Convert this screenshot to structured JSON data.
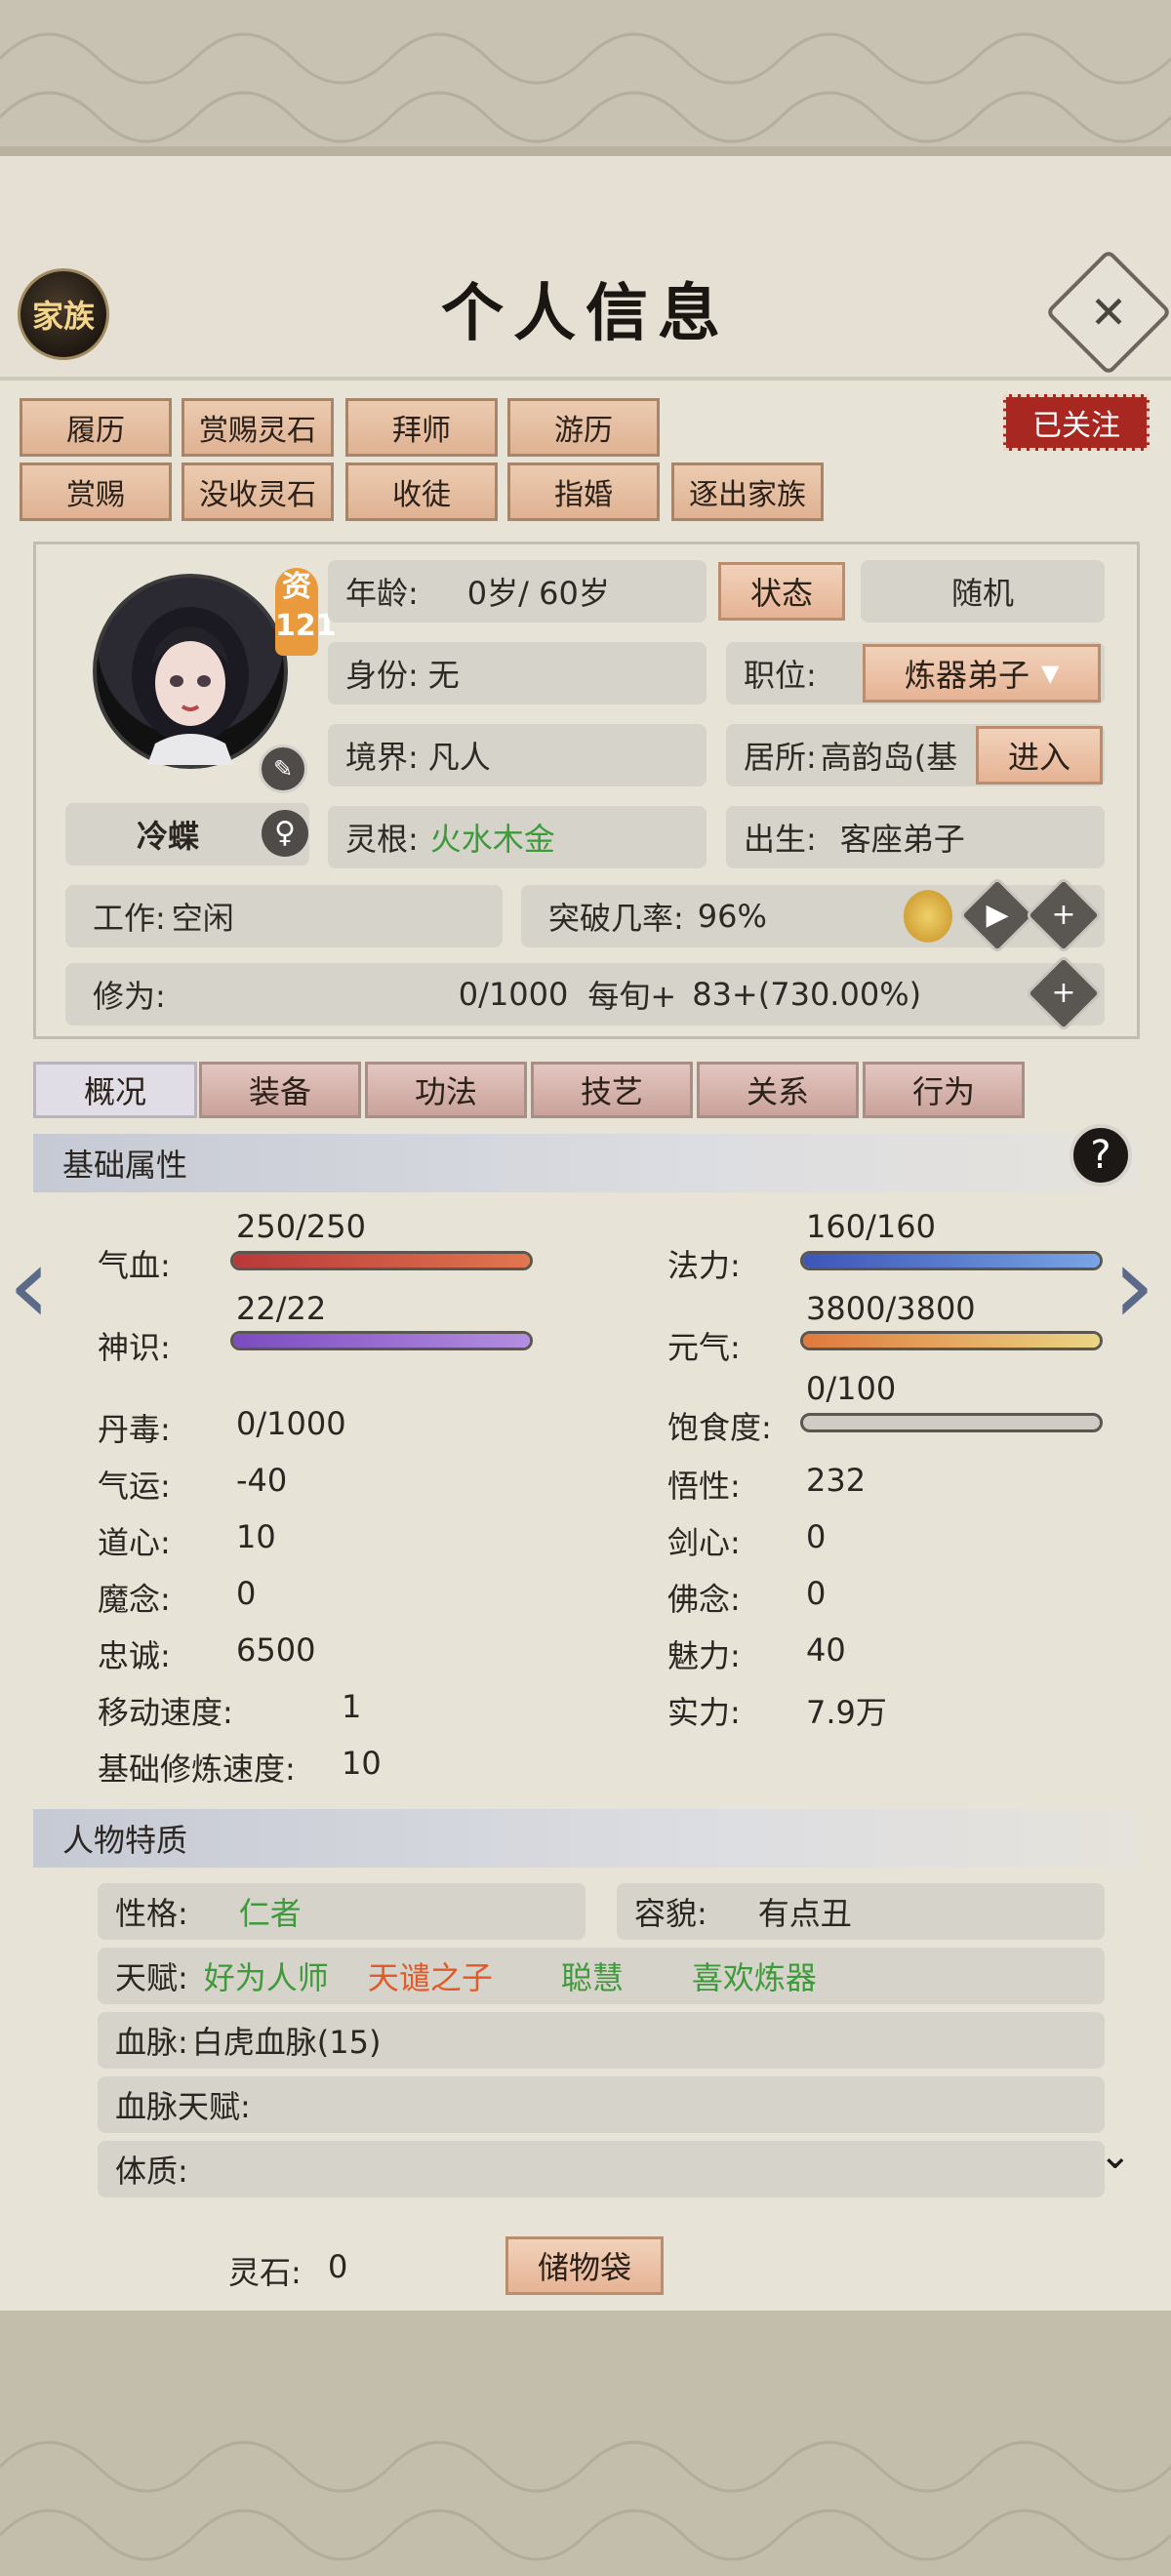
{
  "header": {
    "title": "个人信息",
    "family_label": "家族",
    "close_symbol": "✕",
    "follow_label": "已关注"
  },
  "toolbar_row1": [
    "履历",
    "赏赐灵石",
    "拜师",
    "游历"
  ],
  "toolbar_row2": [
    "赏赐",
    "没收灵石",
    "收徒",
    "指婚",
    "逐出家族"
  ],
  "profile": {
    "aptitude_label": "资",
    "aptitude_value": "121",
    "name": "冷蝶",
    "gender_symbol": "♀",
    "age_label": "年龄:",
    "age_value": "0岁/ 60岁",
    "status_button": "状态",
    "random_button": "随机",
    "identity_label": "身份:",
    "identity_value": "无",
    "position_label": "职位:",
    "position_value": "炼器弟子",
    "realm_label": "境界:",
    "realm_value": "凡人",
    "residence_label": "居所:",
    "residence_value": "高韵岛(基",
    "enter_button": "进入",
    "root_label": "灵根:",
    "root_value": "火水木金",
    "birth_label": "出生:",
    "birth_value": "客座弟子",
    "work_label": "工作:",
    "work_value": "空闲",
    "breakthrough_label": "突破几率:",
    "breakthrough_value": "96%",
    "cultivation_label": "修为:",
    "cultivation_value": "0/1000",
    "per_period_label": "每旬+",
    "per_period_value": "83+(730.00%)"
  },
  "tabs": [
    "概况",
    "装备",
    "功法",
    "技艺",
    "关系",
    "行为"
  ],
  "basic": {
    "section_title": "基础属性",
    "help_symbol": "?",
    "hp": {
      "label": "气血:",
      "text": "250/250",
      "fraction": 1.0
    },
    "mana": {
      "label": "法力:",
      "text": "160/160",
      "fraction": 1.0
    },
    "spirit": {
      "label": "神识:",
      "text": "22/22",
      "fraction": 1.0
    },
    "vital": {
      "label": "元气:",
      "text": "3800/3800",
      "fraction": 1.0
    },
    "satiety": {
      "label": "饱食度:",
      "text": "0/100",
      "fraction": 0.0
    },
    "rows": [
      {
        "l_label": "丹毒:",
        "l_value": "0/1000",
        "r_label": "",
        "r_value": ""
      },
      {
        "l_label": "气运:",
        "l_value": "-40",
        "r_label": "悟性:",
        "r_value": "232"
      },
      {
        "l_label": "道心:",
        "l_value": "10",
        "r_label": "剑心:",
        "r_value": "0"
      },
      {
        "l_label": "魔念:",
        "l_value": "0",
        "r_label": "佛念:",
        "r_value": "0"
      },
      {
        "l_label": "忠诚:",
        "l_value": "6500",
        "r_label": "魅力:",
        "r_value": "40"
      },
      {
        "l_label": "移动速度:",
        "l_value": "1",
        "r_label": "实力:",
        "r_value": "7.9万"
      },
      {
        "l_label": "基础修炼速度:",
        "l_value": "10",
        "r_label": "",
        "r_value": ""
      }
    ]
  },
  "traits": {
    "section_title": "人物特质",
    "personality_label": "性格:",
    "personality_value": "仁者",
    "looks_label": "容貌:",
    "looks_value": "有点丑",
    "talent_label": "天赋:",
    "talents": [
      "好为人师",
      "天谴之子",
      "聪慧",
      "喜欢炼器"
    ],
    "bloodline_label": "血脉:",
    "bloodline_value": "白虎血脉(15)",
    "bloodline_talent_label": "血脉天赋:",
    "physique_label": "体质:"
  },
  "footer": {
    "spirit_stone_label": "灵石:",
    "spirit_stone_value": "0",
    "bag_button": "储物袋"
  },
  "colors": {
    "hp": "#c8493c",
    "mana": "#4866c8",
    "spirit": "#8d62cc",
    "vital": "#e59a45",
    "green_text": "#3e9a3a",
    "orange_text": "#e05a2a",
    "follow_red": "#a92721"
  }
}
